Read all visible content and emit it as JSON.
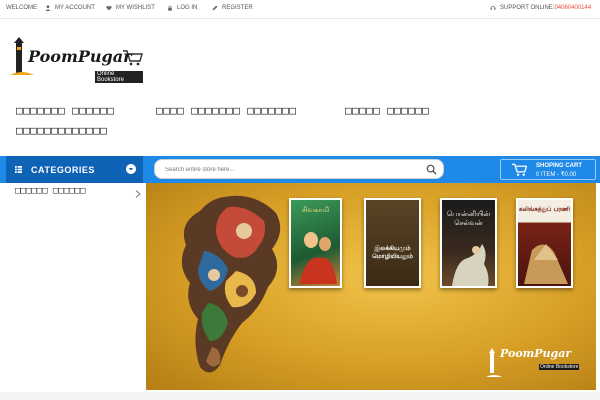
{
  "topbar": {
    "welcome": "WELCOME",
    "my_account": "MY ACCOUNT",
    "my_wishlist": "MY WISHLIST",
    "log_in": "LOG IN",
    "register": "REGISTER",
    "support_label": "SUPPORT ONLINE:",
    "support_phone": "04060400144"
  },
  "logo": {
    "name": "PoomPugar",
    "tagline": "Online Bookstore"
  },
  "nav": {
    "items": [
      "□□□□□□□ □□□□□□",
      "□□□□ □□□□□□□ □□□□□□□",
      "□□□□□ □□□□□□",
      "□□□□□□□□□□□□□"
    ]
  },
  "categories": {
    "title": "CATEGORIES",
    "items": [
      "□□□□□□ □□□□□□"
    ]
  },
  "search": {
    "placeholder": "Search entire store here..."
  },
  "cart": {
    "title": "SHOPING CART",
    "summary": "0 ITEM - ₹0.00"
  },
  "banner": {
    "books": [
      {
        "title": "சிவகாமி",
        "color": "#2a8a4a"
      },
      {
        "title": "இலக்கியமும் மொழியியலும்",
        "color": "#4a3a1e"
      },
      {
        "title": "பொன்னியின் செல்வன்",
        "color": "#1d1d1d"
      },
      {
        "title": "கலிங்கத்துப் பரணி",
        "color": "#7a2216"
      }
    ]
  },
  "colors": {
    "bar": "#1e89e6",
    "categories_bg": "#0f63b7",
    "accent": "#e84c3d",
    "banner": "#d79f25"
  }
}
